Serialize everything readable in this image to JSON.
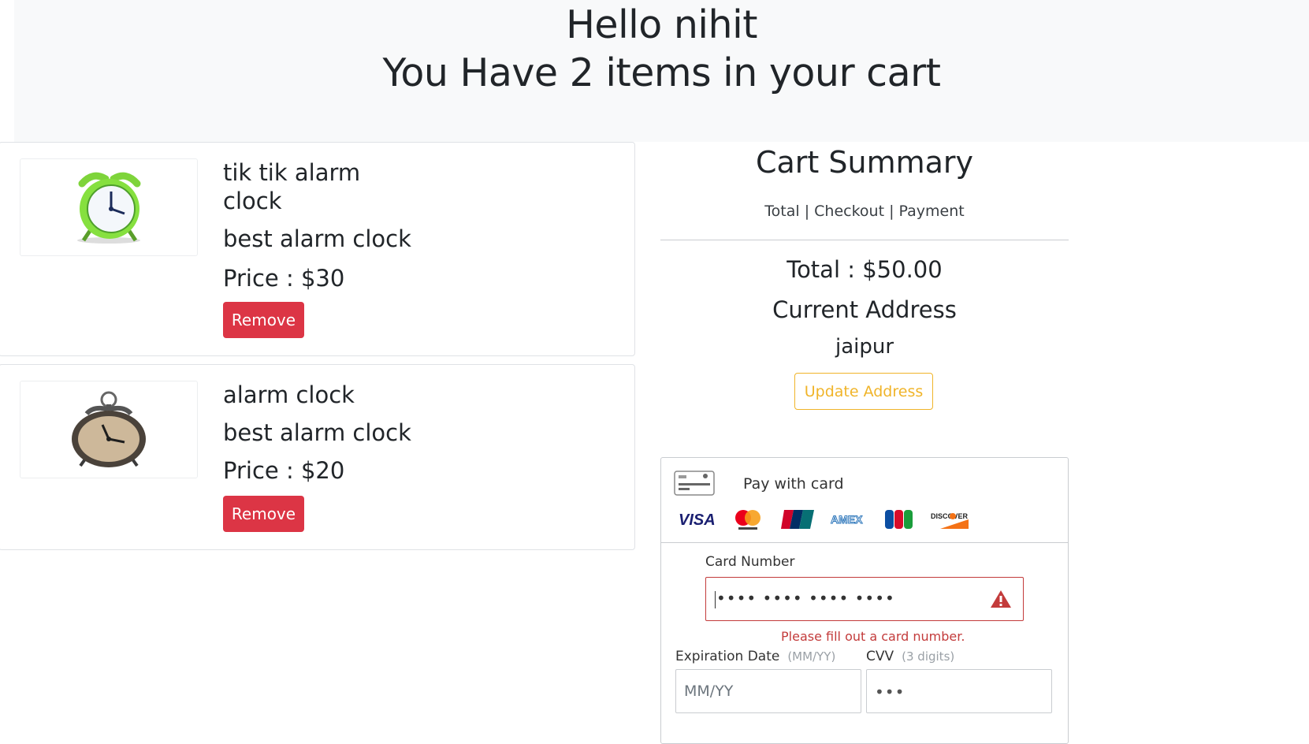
{
  "header": {
    "greeting": "Hello nihit",
    "cart_count_text": "You Have 2 items in your cart"
  },
  "cart_items": [
    {
      "name_line1": "tik tik alarm",
      "name_line2": "clock",
      "description": "best alarm clock",
      "price": "Price : $30",
      "remove_label": "Remove",
      "image_icon": "green-alarm-clock"
    },
    {
      "name": "alarm clock",
      "description": "best alarm clock",
      "price": "Price : $20",
      "remove_label": "Remove",
      "image_icon": "vintage-alarm-clock"
    }
  ],
  "summary": {
    "title": "Cart Summary",
    "steps": "Total | Checkout | Payment",
    "total": "Total : $50.00",
    "address_heading": "Current Address",
    "address": "jaipur",
    "update_label": "Update Address"
  },
  "payment": {
    "header_label": "Pay with card",
    "brands": [
      "visa",
      "mastercard",
      "unionpay",
      "amex",
      "jcb",
      "discover"
    ],
    "card_number_label": "Card Number",
    "card_number_placeholder": "•••• •••• •••• ••••",
    "card_number_error": "Please fill out a card number.",
    "expiry_label": "Expiration Date",
    "expiry_hint": "(MM/YY)",
    "expiry_placeholder": "MM/YY",
    "cvv_label": "CVV",
    "cvv_hint": "(3 digits)",
    "cvv_placeholder": "•••"
  },
  "colors": {
    "danger": "#dc3545",
    "warning": "#f0b429",
    "error": "#c33b3b",
    "hero_bg": "#f8f9fa"
  }
}
